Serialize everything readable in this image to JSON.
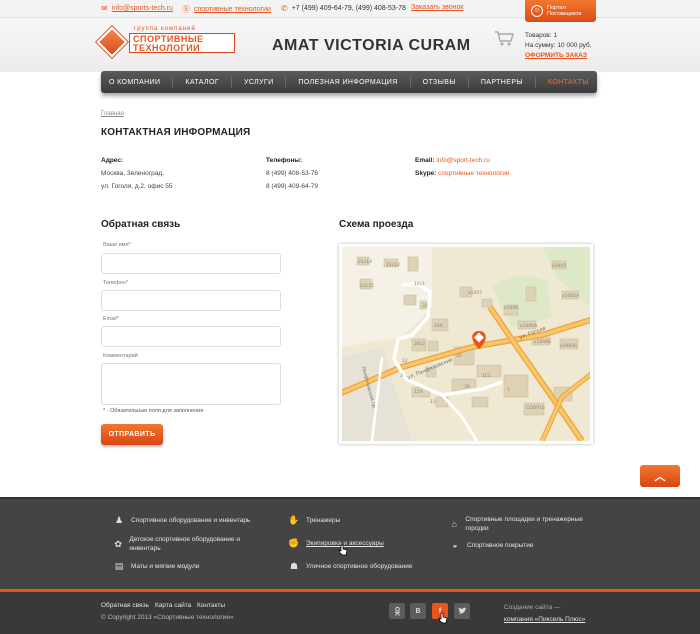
{
  "topbar": {
    "email": "info@sports-tech.ru",
    "skype": "спортивные технологии",
    "phones": "+7 (499) 409-64-79,  (499) 408-53-78",
    "callback": "Заказать звонок",
    "portal_line1": "Портал",
    "portal_line2": "Поставщиков"
  },
  "logo": {
    "line1": "группа компаний",
    "line2": "СПОРТИВНЫЕ",
    "line3": "ТЕХНОЛОГИИ"
  },
  "slogan": "AMAT VICTORIA CURAM",
  "cart": {
    "items": "Товаров: 1",
    "sum": "На сумму: 10 000 руб.",
    "order": "ОФОРМИТЬ ЗАКАЗ"
  },
  "nav": [
    {
      "label": "О КОМПАНИИ"
    },
    {
      "label": "КАТАЛОГ"
    },
    {
      "label": "УСЛУГИ"
    },
    {
      "label": "ПОЛЕЗНАЯ ИНФОРМАЦИЯ"
    },
    {
      "label": "ОТЗЫВЫ"
    },
    {
      "label": "ПАРТНЕРЫ"
    },
    {
      "label": "КОНТАКТЫ"
    }
  ],
  "breadcrumb": "Главная",
  "page_title": "КОНТАКТНАЯ ИНФОРМАЦИЯ",
  "contacts": {
    "address_label": "Адрес:",
    "address_line1": "Москва, Зеленоград,",
    "address_line2": "ул. Гоголя, д.2, офис 55",
    "phones_label": "Телефоны:",
    "phone1": "8 (499) 408-53-78",
    "phone2": "8 (499) 409-64-79",
    "email_label": "Email:",
    "email": "info@sport-tech.ru",
    "skype_label": "Skype:",
    "skype": "спортивные технологии"
  },
  "feedback": {
    "title": "Обратная связь",
    "name_label": "Ваше имя*",
    "phone_label": "Телефон*",
    "email_label": "Email*",
    "comment_label": "Комментарий",
    "note": "* - Обязательные поля для заполнения",
    "submit": "ОТПРАВИТЬ"
  },
  "map": {
    "title": "Схема проезда",
    "street_gogol": "ул. Гоголя",
    "street_panfil": "ул. Панфиловский",
    "street_left": "Панфиловский пр.",
    "labels": [
      "21с14",
      "21с12",
      "21с15",
      "16с1",
      "32",
      "х1007",
      "х1006",
      "х1005",
      "х1006А",
      "х1006Б",
      "26А",
      "26с2",
      "26",
      "1С1",
      "30",
      "1",
      "15А",
      "13",
      "COOP10",
      "х1004Б",
      "х1004Е",
      "х1005А",
      "3",
      "12"
    ]
  },
  "footer": {
    "col1": [
      "Спортивное оборудование и инвентарь",
      "Детское спортивное оборудование и инвентарь",
      "Маты и мягкие модули"
    ],
    "col2": [
      "Тренажеры",
      "Экипировка и аксессуары",
      "Уличное спортивное оборудование"
    ],
    "col3": [
      "Спортивные площадки и тренажерные городки",
      "Спортивное покрытие"
    ],
    "links": [
      "Обратная связь",
      "Карта сайта",
      "Контакты"
    ],
    "copyright": "© Copyright  2013  «Спортивные технологии»",
    "social": [
      "ok",
      "В",
      "f",
      "tw"
    ],
    "made_by": "Создание сайта  —",
    "made_link": "компания «Пиксель Плюс»"
  }
}
